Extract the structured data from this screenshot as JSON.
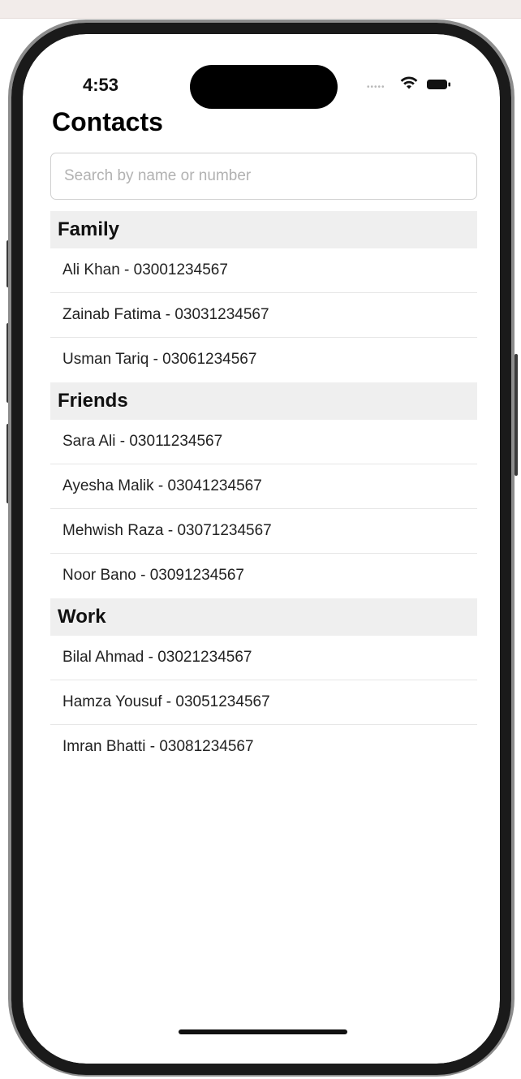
{
  "status_bar": {
    "time": "4:53"
  },
  "title": "Contacts",
  "search": {
    "placeholder": "Search by name or number",
    "value": ""
  },
  "sections": [
    {
      "title": "Family",
      "contacts": [
        "Ali Khan - 03001234567",
        "Zainab Fatima - 03031234567",
        "Usman Tariq - 03061234567"
      ]
    },
    {
      "title": "Friends",
      "contacts": [
        "Sara Ali - 03011234567",
        "Ayesha Malik - 03041234567",
        "Mehwish Raza - 03071234567",
        "Noor Bano - 03091234567"
      ]
    },
    {
      "title": "Work",
      "contacts": [
        "Bilal Ahmad - 03021234567",
        "Hamza Yousuf - 03051234567",
        "Imran Bhatti - 03081234567"
      ]
    }
  ]
}
